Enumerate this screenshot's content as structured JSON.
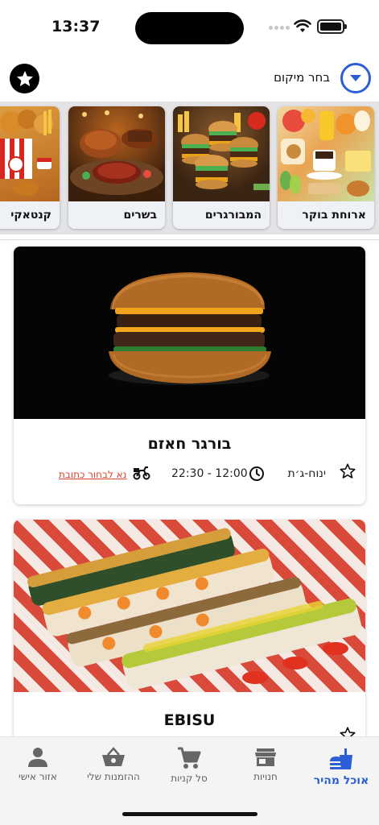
{
  "status": {
    "time": "13:37"
  },
  "header": {
    "location_label": "בחר מיקום",
    "icons": [
      "star-icon",
      "chevron-down-icon"
    ],
    "accent_color": "#2c5fd6"
  },
  "categories": [
    {
      "label": "ארוחת בוקר",
      "icon": "breakfast-photo"
    },
    {
      "label": "המבורגרים",
      "icon": "burgers-photo"
    },
    {
      "label": "בשרים",
      "icon": "meats-photo"
    },
    {
      "label": "קנטאקי",
      "icon": "fried-chicken-photo"
    }
  ],
  "restaurants": [
    {
      "name": "בורגר חאזם",
      "days": "ינוח-ג׳ת",
      "hours": "22:30 - 12:00",
      "address_link": "נא לבחור כתובת"
    },
    {
      "name": "EBISU"
    }
  ],
  "bottom_nav": [
    {
      "label": "אוכל מהיר",
      "icon": "fast-food-icon",
      "active": true
    },
    {
      "label": "חנויות",
      "icon": "store-icon",
      "active": false
    },
    {
      "label": "סל קניות",
      "icon": "cart-icon",
      "active": false
    },
    {
      "label": "ההזמנות שלי",
      "icon": "basket-icon",
      "active": false
    },
    {
      "label": "אזור אישי",
      "icon": "person-icon",
      "active": false
    }
  ]
}
